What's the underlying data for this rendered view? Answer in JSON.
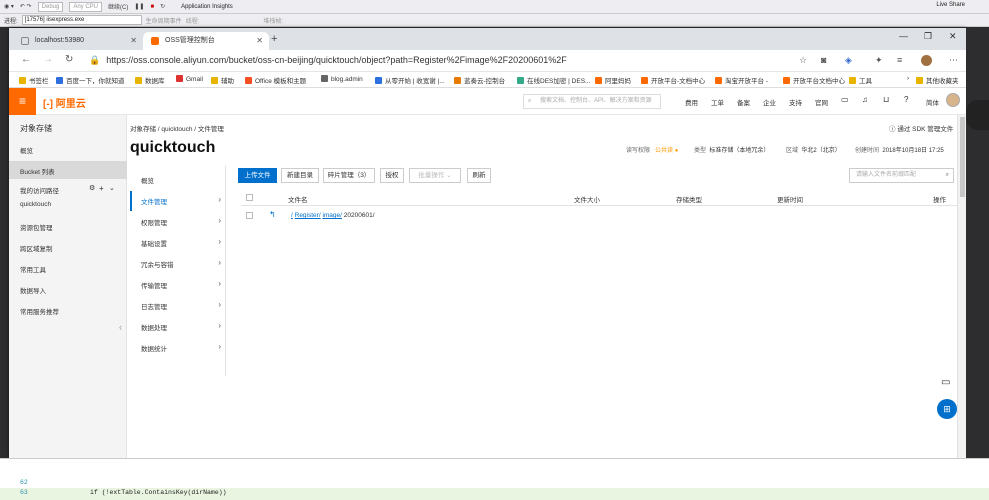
{
  "vs": {
    "toolbar": {
      "debug_label": "Debug",
      "cpu_label": "Any CPU",
      "continue_label": "继续(C)",
      "app_insights": "Application Insights",
      "live_share": "Live Share"
    },
    "toolbar2": {
      "process_label": "进程:",
      "process_value": "[17576] iisexpress.exe",
      "lifecycle_label": "生命周期事件",
      "thread_label": "线程:",
      "stack_label": "堆栈帧:"
    },
    "code": {
      "lines": [
        {
          "num": "62",
          "text": ""
        },
        {
          "num": "63",
          "text": "if (!extTable.ContainsKey(dirName))"
        },
        {
          "num": "64",
          "text": "{"
        }
      ]
    }
  },
  "browser": {
    "tabs": [
      {
        "title": "localhost:53980",
        "active": false
      },
      {
        "title": "OSS管理控制台",
        "active": true
      }
    ],
    "url": "https://oss.console.aliyun.com/bucket/oss-cn-beijing/quicktouch/object?path=Register%2Fimage%2F20200601%2F",
    "bookmarks": [
      "书签栏",
      "百度一下，你就知道",
      "数据库",
      "Gmail",
      "辅助",
      "Office 模板和主题",
      "blog.admin",
      "从零开始 | 收宽谢 |...",
      "蓝奏云-控制台",
      "在线DES加密 | DES...",
      "阿里妈妈",
      "开放平台-文档中心",
      "淘宝开放平台 -",
      "开放平台文档中心",
      "工具",
      "其他收藏夹"
    ]
  },
  "aliyun": {
    "logo": "阿里云",
    "search_placeholder": "搜索文档、控制台、API、解决方案和资源",
    "nav": [
      "费用",
      "工单",
      "备案",
      "企业",
      "支持",
      "官网"
    ],
    "user": "简体",
    "sidebar": {
      "title": "对象存储",
      "items": [
        "概览",
        "Bucket 列表",
        "我的访问路径",
        "quicktouch",
        "资源包管理",
        "跨区域复制",
        "常用工具",
        "数据导入",
        "常用服务推荐"
      ]
    },
    "bucket": {
      "breadcrumb": "对象存储 / quicktouch / 文件管理",
      "name": "quicktouch",
      "sdk_link": "通过 SDK 管理文件",
      "acl_label": "读写权限",
      "acl_value": "公共读",
      "type_label": "类型",
      "type_value": "标准存储（本地冗余）",
      "region_label": "区域",
      "region_value": "华北2（北京）",
      "created_label": "创建时间",
      "created_value": "2018年10月18日 17:25"
    },
    "submenu": [
      "概览",
      "文件管理",
      "权限管理",
      "基础设置",
      "冗余与容错",
      "传输管理",
      "日志管理",
      "数据处理",
      "数据统计"
    ],
    "toolbar": {
      "upload": "上传文件",
      "new_dir": "新建目录",
      "fragments": "碎片管理（3）",
      "authorize": "授权",
      "batch": "批量操作",
      "refresh": "刷新",
      "search_placeholder": "请输入文件名前缀匹配"
    },
    "table": {
      "headers": [
        "文件名",
        "文件大小",
        "存储类型",
        "更新时间",
        "操作"
      ],
      "path_parts": [
        "/",
        "Register/",
        "image/",
        "20200601/"
      ]
    }
  }
}
